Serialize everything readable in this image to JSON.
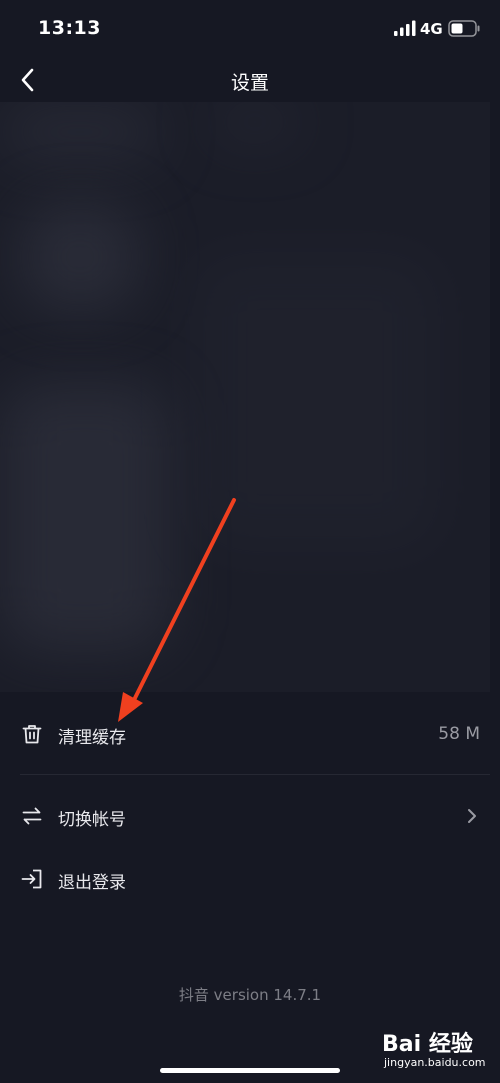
{
  "status_bar": {
    "time": "13:13",
    "network": "4G",
    "signal_icon": "signal-bars-icon",
    "battery_icon": "battery-icon"
  },
  "nav": {
    "title": "设置",
    "back_icon": "chevron-left-icon"
  },
  "settings": {
    "items": [
      {
        "label": "清理缓存",
        "value": "58 M",
        "icon": "trash-icon"
      },
      {
        "label": "切换帐号",
        "icon": "swap-arrows-icon",
        "trailing_icon": "chevron-right-icon"
      },
      {
        "label": "退出登录",
        "icon": "logout-icon"
      }
    ]
  },
  "footer": {
    "version": "抖音 version 14.7.1"
  },
  "watermark": {
    "logo": "Bai 经验",
    "url": "jingyan.baidu.com"
  },
  "colors": {
    "background": "#161823",
    "annotation_arrow": "#f0401f",
    "secondary_text": "#9a9ba3"
  }
}
